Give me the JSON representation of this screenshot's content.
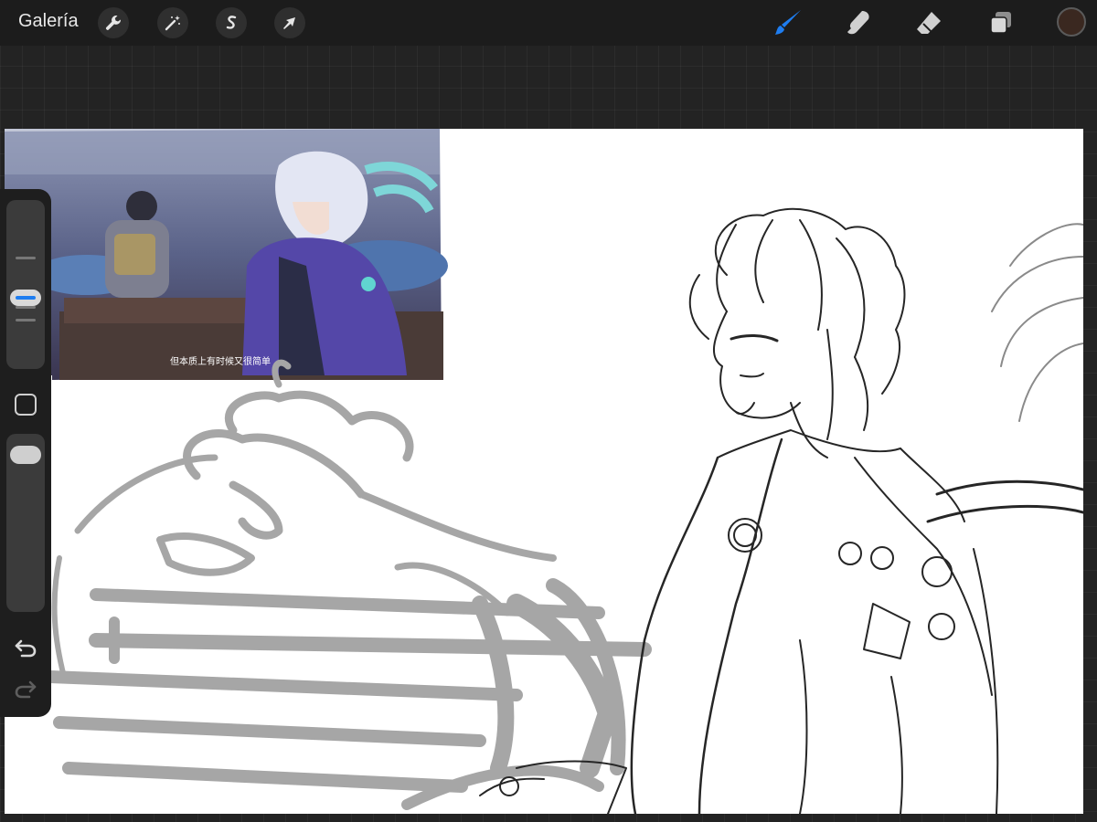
{
  "topbar": {
    "gallery_label": "Galería",
    "left_tools": [
      "wrench-icon",
      "magic-wand-icon",
      "selection-icon",
      "transform-arrow-icon"
    ],
    "right_tools": [
      "brush-icon",
      "smudge-icon",
      "eraser-icon",
      "layers-icon"
    ],
    "active_tool": "brush-icon",
    "accent_color": "#1e7df0",
    "current_color": "#3a2820"
  },
  "reference": {
    "subtitle": "但本质上有时候又很简单"
  },
  "sidebar": {
    "size_slider_fraction": 0.5,
    "opacity_slider_fraction": 0.0,
    "controls": [
      "modify-button",
      "undo-icon",
      "redo-icon"
    ]
  }
}
